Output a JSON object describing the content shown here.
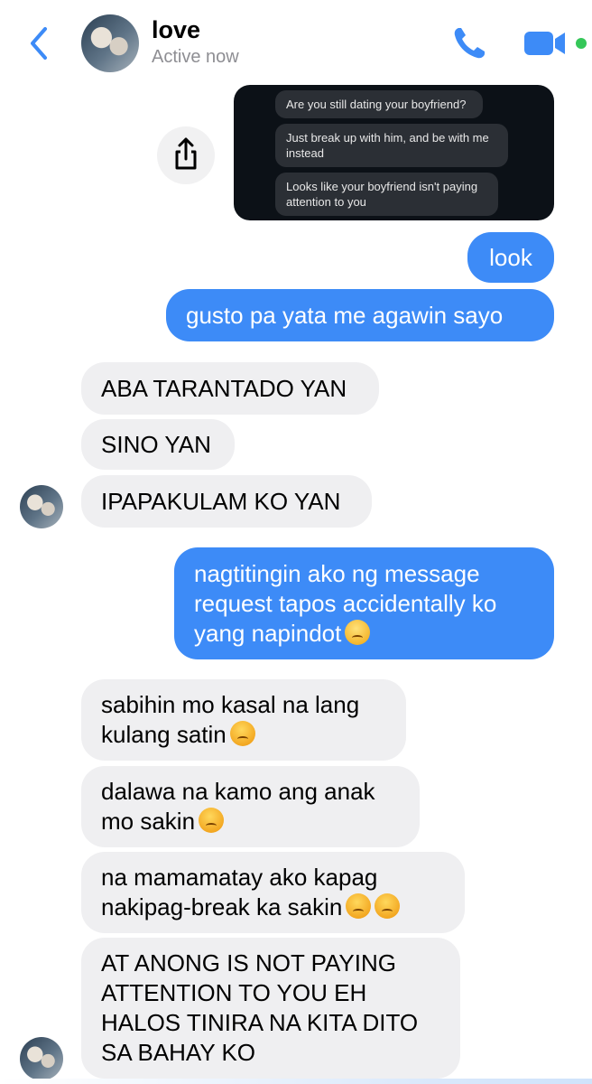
{
  "header": {
    "back_icon": "chevron-left-icon",
    "contact_name": "love",
    "status": "Active now",
    "call_icon": "phone-icon",
    "video_icon": "video-camera-icon",
    "accent": "#3d8bf7",
    "online_color": "#35c759"
  },
  "screenshot": {
    "messages": [
      "Are you still dating your boyfriend?",
      "Just break up with him, and be with me instead",
      "Looks like your boyfriend isn't paying attention to you"
    ],
    "share_icon": "share-icon"
  },
  "messages": [
    {
      "side": "out",
      "text": "look"
    },
    {
      "side": "out",
      "text": "gusto pa yata me agawin sayo"
    },
    {
      "side": "in",
      "text": "ABA TARANTADO YAN"
    },
    {
      "side": "in",
      "text": "SINO YAN"
    },
    {
      "side": "in",
      "text": "IPAPAKULAM KO YAN"
    },
    {
      "side": "out",
      "line1": "nagtitingin ako ng message",
      "line2": "request tapos accidentally ko",
      "line3": "yang napindot"
    },
    {
      "side": "in",
      "line1": "sabihin mo kasal na lang",
      "line2": "kulang satin"
    },
    {
      "side": "in",
      "line1": "dalawa na kamo ang anak",
      "line2": "mo sakin"
    },
    {
      "side": "in",
      "line1": "na mamamatay ako kapag",
      "line2": "nakipag-break ka sakin"
    },
    {
      "side": "in",
      "line1": "AT ANONG IS NOT PAYING",
      "line2": "ATTENTION TO YOU EH",
      "line3": "HALOS TINIRA NA KITA DITO",
      "line4": "SA BAHAY KO"
    }
  ],
  "colors": {
    "outgoing_bubble": "#3d8bf7",
    "incoming_bubble": "#efeff1"
  }
}
